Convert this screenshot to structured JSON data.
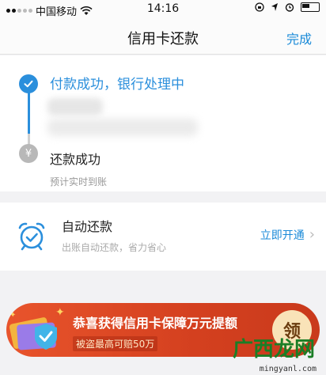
{
  "status_bar": {
    "carrier": "中国移动",
    "time": "14:16",
    "icons": [
      "signal-dots",
      "wifi-icon",
      "location-icon",
      "lock-rotation-icon",
      "alarm-icon",
      "battery-icon"
    ]
  },
  "nav": {
    "title": "信用卡还款",
    "done_label": "完成"
  },
  "progress": {
    "step1_title": "付款成功，银行处理中",
    "step2_icon_glyph": "¥",
    "step2_title": "还款成功",
    "step2_subtitle": "预计实时到账"
  },
  "autopay": {
    "title": "自动还款",
    "subtitle": "出账自动还款，省力省心",
    "action_label": "立即开通",
    "chevron": "›"
  },
  "banner": {
    "title": "恭喜获得信用卡保障万元提额",
    "subtitle": "被盗最高可赔50万",
    "button_label": "领"
  },
  "watermark": {
    "text": "广西龙网",
    "url": "mingyanl.com"
  },
  "colors": {
    "accent": "#2b8fdc",
    "banner": "#d4401f"
  }
}
